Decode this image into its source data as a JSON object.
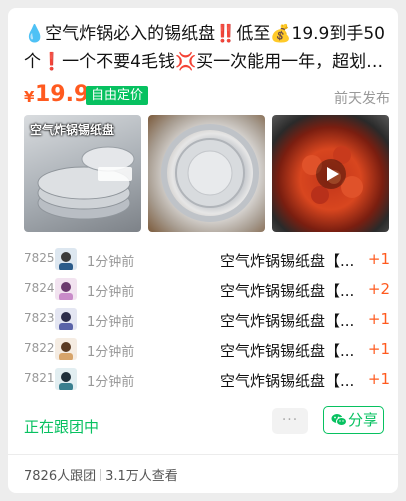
{
  "post": {
    "title": "💧空气炸锅必入的锡纸盘‼️低至💰19.9到手50个❗️一个不要4毛钱💢买一次能用一年，超划算‼️...",
    "price_symbol": "¥",
    "price": "19.9",
    "price_badge": "自由定价",
    "posted_time": "前天发布",
    "image_caption": "空气炸锅锡纸盘",
    "images": [
      {
        "name": "foil-pans-stack"
      },
      {
        "name": "foil-pan-closeup"
      },
      {
        "name": "crayfish-video",
        "has_video": true
      }
    ]
  },
  "orders": [
    {
      "id": "7825",
      "time": "1分钟前",
      "product": "空气炸锅锡纸盘【...",
      "qty": "+1"
    },
    {
      "id": "7824",
      "time": "1分钟前",
      "product": "空气炸锅锡纸盘【...",
      "qty": "+2"
    },
    {
      "id": "7823",
      "time": "1分钟前",
      "product": "空气炸锅锡纸盘【...",
      "qty": "+1"
    },
    {
      "id": "7822",
      "time": "1分钟前",
      "product": "空气炸锅锡纸盘【...",
      "qty": "+1"
    },
    {
      "id": "7821",
      "time": "1分钟前",
      "product": "空气炸锅锡纸盘【...",
      "qty": "+1"
    }
  ],
  "actions": {
    "status": "正在跟团中",
    "more": "···",
    "share": "分享"
  },
  "footer": {
    "participants": "7826人跟团",
    "views": "3.1万人查看"
  },
  "colors": {
    "accent_green": "#07c160",
    "price_orange": "#ff5a1f",
    "muted": "#999999"
  }
}
